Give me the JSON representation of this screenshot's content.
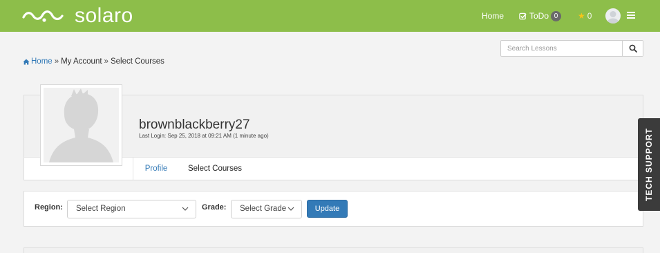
{
  "brand": {
    "name": "solaro",
    "accent": "#8dbe4a"
  },
  "nav": {
    "home_label": "Home",
    "todo_label": "ToDo",
    "todo_count": "0",
    "stars_count": "0",
    "todo_icon": "check-square-icon",
    "stars_icon": "star-icon",
    "menu_icon": "hamburger-icon"
  },
  "search": {
    "placeholder": "Search Lessons",
    "icon": "search-icon"
  },
  "breadcrumb": {
    "home": "Home",
    "sep": "»",
    "account": "My Account",
    "current": "Select Courses"
  },
  "profile": {
    "username": "brownblackberry27",
    "last_login": "Last Login: Sep 25, 2018 at 09:21 AM (1 minute ago)",
    "tabs": [
      {
        "label": "Profile"
      },
      {
        "label": "Select Courses"
      }
    ]
  },
  "filters": {
    "region_label": "Region:",
    "region_value": "Select Region",
    "grade_label": "Grade:",
    "grade_value": "Select Grade",
    "update_label": "Update",
    "button_color": "#337ab7"
  },
  "support": {
    "label": "TECH SUPPORT"
  }
}
